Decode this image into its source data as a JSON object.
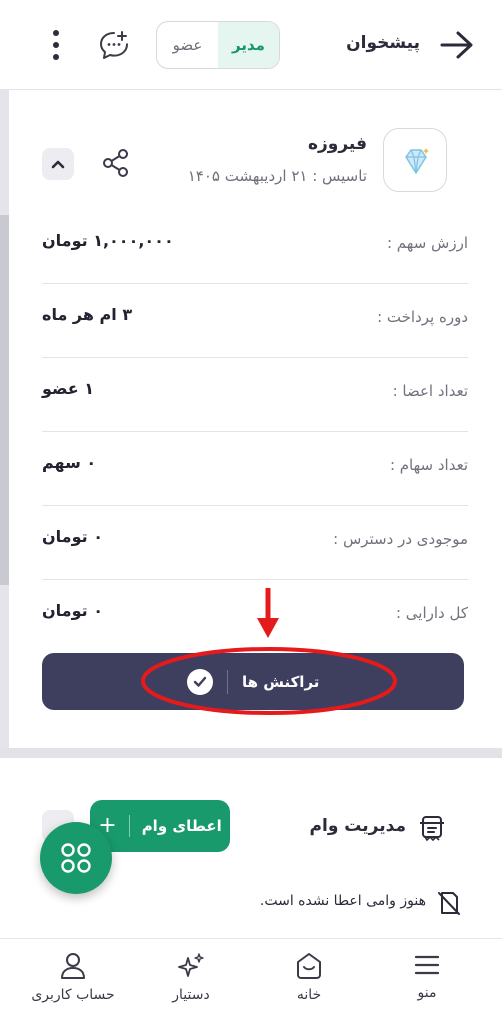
{
  "header": {
    "title": "پیشخوان",
    "role_toggle": {
      "active": "مدیر",
      "inactive": "عضو"
    },
    "icons": [
      "arrow-right-icon",
      "chat-plus-icon",
      "more-vertical-icon"
    ]
  },
  "group": {
    "name": "فیروزه",
    "founded": "تاسیس : ۲۱ اردیبهشت ۱۴۰۵",
    "logo_icon": "diamond-icon",
    "rows": [
      {
        "label": "ارزش سهم :",
        "value": "۱,۰۰۰,۰۰۰ تومان"
      },
      {
        "label": "دوره پرداخت :",
        "value": "۳ ام هر ماه"
      },
      {
        "label": "تعداد اعضا :",
        "value": "۱ عضو"
      },
      {
        "label": "تعداد سهام :",
        "value": "۰ سهم"
      },
      {
        "label": "موجودی در دسترس :",
        "value": "۰ تومان"
      },
      {
        "label": "کل دارایی :",
        "value": "۰ تومان"
      }
    ],
    "transactions_button": "تراکنش ها"
  },
  "loan": {
    "title": "مدیریت وام",
    "give_loan_button": "اعطای وام",
    "empty_text": "هنوز وامی اعطا نشده است."
  },
  "nav": {
    "items": [
      {
        "label": "منو",
        "icon": "menu-icon"
      },
      {
        "label": "خانه",
        "icon": "home-icon"
      },
      {
        "label": "دستیار",
        "icon": "sparkle-icon"
      },
      {
        "label": "حساب کاربری",
        "icon": "user-icon"
      }
    ]
  },
  "colors": {
    "primary_dark": "#3e3e5e",
    "accent_green": "#189a6c",
    "annotation_red": "#e51b1b"
  }
}
